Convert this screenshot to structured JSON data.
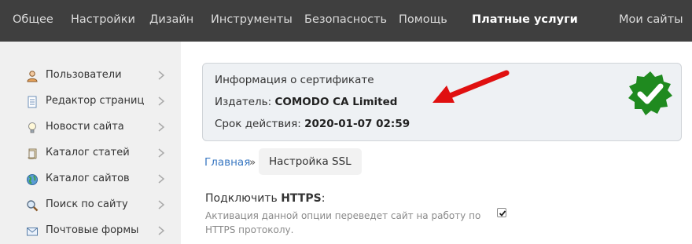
{
  "topnav": {
    "items": [
      "Общее",
      "Настройки",
      "Дизайн",
      "Инструменты",
      "Безопасность",
      "Помощь"
    ],
    "active": "Платные услуги",
    "right": "Мои сайты"
  },
  "sidebar": {
    "items": [
      {
        "label": "Пользователи",
        "icon": "user-icon"
      },
      {
        "label": "Редактор страниц",
        "icon": "page-icon"
      },
      {
        "label": "Новости сайта",
        "icon": "lightbulb-icon"
      },
      {
        "label": "Каталог статей",
        "icon": "scroll-icon"
      },
      {
        "label": "Каталог сайтов",
        "icon": "globe-icon"
      },
      {
        "label": "Поиск по сайту",
        "icon": "magnifier-icon"
      },
      {
        "label": "Почтовые формы",
        "icon": "envelope-icon"
      }
    ]
  },
  "cert": {
    "title": "Информация о сертификате",
    "issuer_label": "Издатель: ",
    "issuer": "COMODO CA Limited",
    "expiry_label": "Срок действия: ",
    "expiry": "2020-01-07 02:59",
    "badge_icon": "verified-badge-icon",
    "badge_color": "#1f8a1f",
    "arrow_color": "#e01010"
  },
  "breadcrumb": {
    "home": "Главная",
    "separator": "»",
    "current": "Настройка SSL"
  },
  "setting": {
    "title_prefix": "Подключить ",
    "title_bold": "HTTPS",
    "title_suffix": ":",
    "description": "Активация данной опции переведет сайт на работу по HTTPS протоколу.",
    "checked": true
  }
}
